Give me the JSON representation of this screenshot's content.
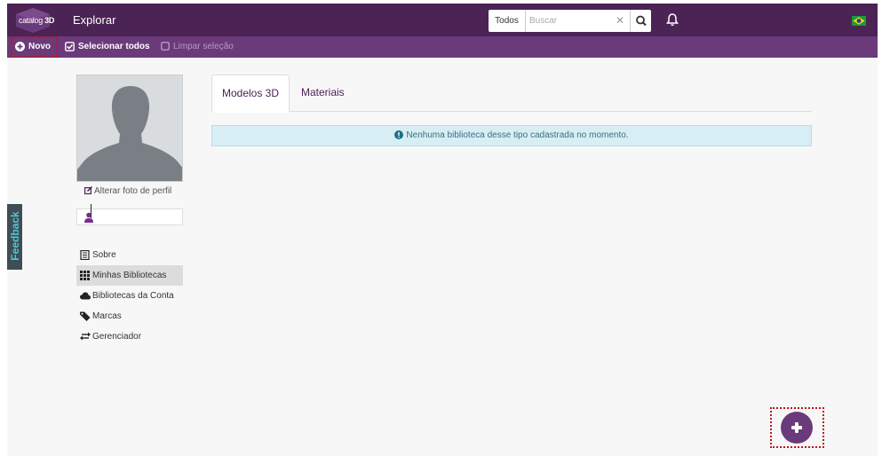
{
  "app": {
    "logo": {
      "name": "catalog",
      "suffix": "3D"
    },
    "nav": {
      "explorar": "Explorar"
    }
  },
  "search": {
    "scope": "Todos",
    "placeholder": "Buscar",
    "clear_icon": "close-icon",
    "submit_icon": "search-icon"
  },
  "header_icons": {
    "notifications": "bell-icon",
    "language": "brazil-flag-icon"
  },
  "toolbar": {
    "novo": "Novo",
    "selecionar_todos": "Selecionar todos",
    "limpar_selecao": "Limpar seleção"
  },
  "profile": {
    "change_photo": "Alterar foto de perfil",
    "name_value": ""
  },
  "sidebar": {
    "items": [
      {
        "label": "Sobre",
        "icon": "document-icon",
        "active": false
      },
      {
        "label": "Minhas Bibliotecas",
        "icon": "grid-icon",
        "active": true
      },
      {
        "label": "Bibliotecas da Conta",
        "icon": "cloud-icon",
        "active": false
      },
      {
        "label": "Marcas",
        "icon": "tag-icon",
        "active": false
      },
      {
        "label": "Gerenciador",
        "icon": "exchange-icon",
        "active": false
      }
    ]
  },
  "feedback": {
    "label": "Feedback"
  },
  "main": {
    "tabs": [
      {
        "label": "Modelos 3D",
        "active": true
      },
      {
        "label": "Materiais",
        "active": false
      }
    ],
    "alert": "Nenhuma biblioteca desse tipo cadastrada no momento."
  },
  "colors": {
    "brand_dark": "#4b2354",
    "brand": "#6b3a7a",
    "alert_bg": "#d7eef4",
    "feedback_bg": "#3f4d55",
    "feedback_text": "#4fc3d7"
  }
}
